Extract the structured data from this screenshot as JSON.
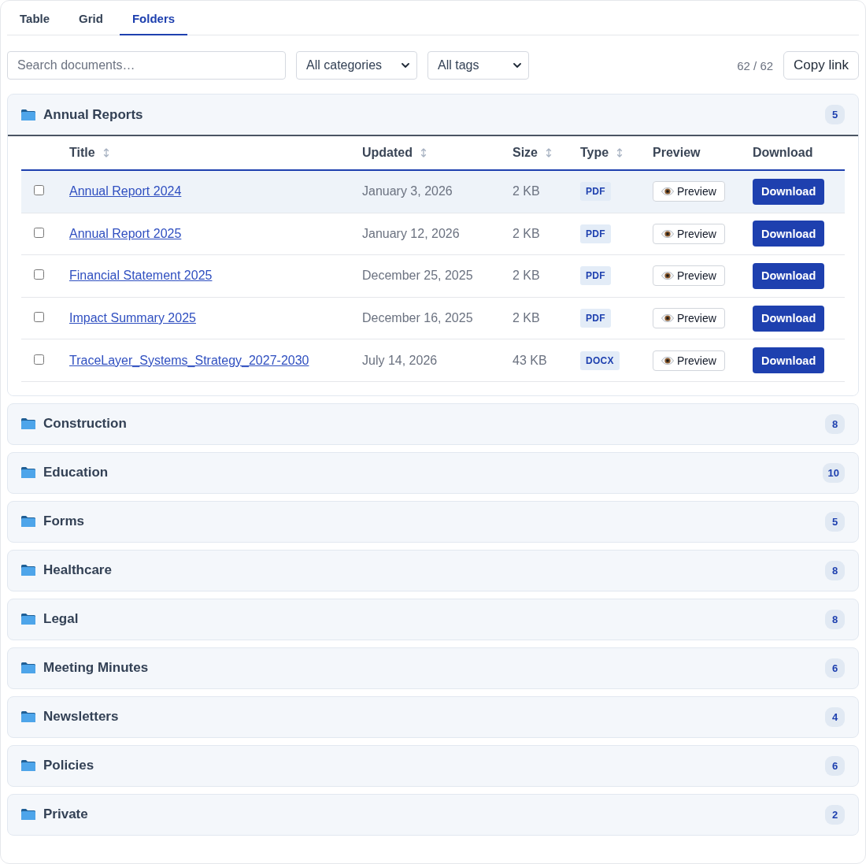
{
  "tabs": [
    {
      "label": "Table",
      "selected": false
    },
    {
      "label": "Grid",
      "selected": false
    },
    {
      "label": "Folders",
      "selected": true
    }
  ],
  "toolbar": {
    "search": {
      "placeholder": "Search documents…"
    },
    "filters": [
      {
        "value": "All categories"
      },
      {
        "value": "All tags"
      }
    ],
    "result_count": "62 / 62",
    "copy_link_button": "Copy link"
  },
  "folders": [
    {
      "name": "Annual Reports",
      "count": "5",
      "expanded": true,
      "table": {
        "columns": [
          {
            "label": "Title",
            "sortable": true
          },
          {
            "label": "Updated",
            "sortable": true
          },
          {
            "label": "Size",
            "sortable": true
          },
          {
            "label": "Type",
            "sortable": true
          },
          {
            "label": "Preview",
            "sortable": false
          },
          {
            "label": "Download",
            "sortable": false
          }
        ],
        "rows": [
          {
            "checked": false,
            "highlighted": true,
            "title": "Annual Report 2024",
            "updated": "January 3, 2026",
            "size": "2 KB",
            "type": "PDF",
            "preview": "Preview",
            "download": "Download"
          },
          {
            "checked": false,
            "highlighted": false,
            "title": "Annual Report 2025",
            "updated": "January 12, 2026",
            "size": "2 KB",
            "type": "PDF",
            "preview": "Preview",
            "download": "Download"
          },
          {
            "checked": false,
            "highlighted": false,
            "title": "Financial Statement 2025",
            "updated": "December 25, 2025",
            "size": "2 KB",
            "type": "PDF",
            "preview": "Preview",
            "download": "Download"
          },
          {
            "checked": false,
            "highlighted": false,
            "title": "Impact Summary 2025",
            "updated": "December 16, 2025",
            "size": "2 KB",
            "type": "PDF",
            "preview": "Preview",
            "download": "Download"
          },
          {
            "checked": false,
            "highlighted": false,
            "title": "TraceLayer_Systems_Strategy_2027-2030",
            "updated": "July 14, 2026",
            "size": "43 KB",
            "type": "DOCX",
            "preview": "Preview",
            "download": "Download"
          }
        ]
      }
    },
    {
      "name": "Construction",
      "count": "8",
      "expanded": false
    },
    {
      "name": "Education",
      "count": "10",
      "expanded": false
    },
    {
      "name": "Forms",
      "count": "5",
      "expanded": false
    },
    {
      "name": "Healthcare",
      "count": "8",
      "expanded": false
    },
    {
      "name": "Legal",
      "count": "8",
      "expanded": false
    },
    {
      "name": "Meeting Minutes",
      "count": "6",
      "expanded": false
    },
    {
      "name": "Newsletters",
      "count": "4",
      "expanded": false
    },
    {
      "name": "Policies",
      "count": "6",
      "expanded": false
    },
    {
      "name": "Private",
      "count": "2",
      "expanded": false
    }
  ]
}
